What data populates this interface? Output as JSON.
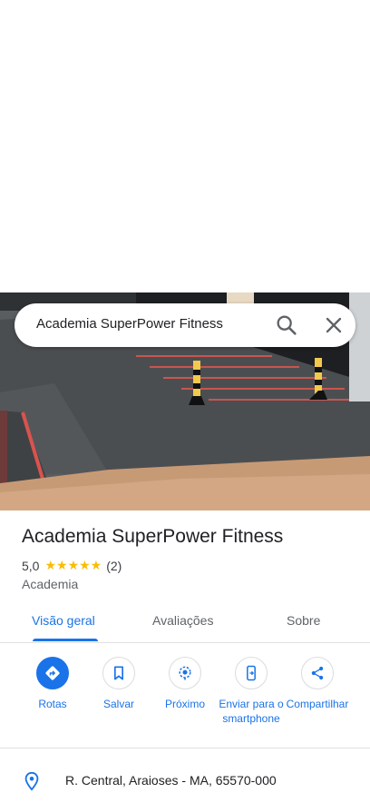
{
  "search": {
    "query": "Academia SuperPower Fitness"
  },
  "place": {
    "name": "Academia SuperPower Fitness",
    "rating": "5,0",
    "review_count": "(2)",
    "stars": "★★★★★",
    "category": "Academia",
    "address": "R. Central, Araioses - MA, 65570-000"
  },
  "tabs": [
    {
      "label": "Visão geral",
      "active": true
    },
    {
      "label": "Avaliações",
      "active": false
    },
    {
      "label": "Sobre",
      "active": false
    }
  ],
  "actions": [
    {
      "label": "Rotas",
      "icon": "directions-icon"
    },
    {
      "label": "Salvar",
      "icon": "bookmark-icon"
    },
    {
      "label": "Próximo",
      "icon": "nearby-icon"
    },
    {
      "label": "Enviar para o smartphone",
      "icon": "send-to-phone-icon"
    },
    {
      "label": "Compartilhar",
      "icon": "share-icon"
    }
  ],
  "colors": {
    "accent": "#1a73e8",
    "star": "#fbbc04",
    "text": "#202124",
    "muted": "#5f6368"
  }
}
